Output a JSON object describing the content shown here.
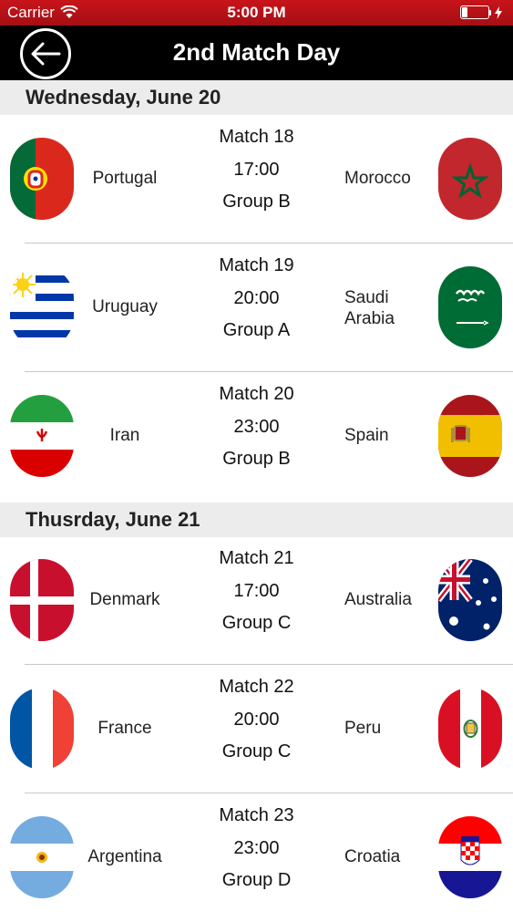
{
  "status_bar": {
    "carrier": "Carrier",
    "time": "5:00 PM"
  },
  "nav": {
    "title": "2nd Match Day",
    "back_icon": "arrow-left-icon"
  },
  "days": [
    {
      "label": "Wednesday, June 20",
      "matches": [
        {
          "match": "Match 18",
          "time": "17:00",
          "group": "Group B",
          "home": "Portugal",
          "away": "Morocco",
          "home_flag": "portugal-flag",
          "away_flag": "morocco-flag"
        },
        {
          "match": "Match 19",
          "time": "20:00",
          "group": "Group A",
          "home": "Uruguay",
          "away": "Saudi\nArabia",
          "home_flag": "uruguay-flag",
          "away_flag": "saudi-arabia-flag"
        },
        {
          "match": "Match 20",
          "time": "23:00",
          "group": "Group B",
          "home": "Iran",
          "away": "Spain",
          "home_flag": "iran-flag",
          "away_flag": "spain-flag"
        }
      ]
    },
    {
      "label": "Thusrday, June 21",
      "matches": [
        {
          "match": "Match 21",
          "time": "17:00",
          "group": "Group C",
          "home": "Denmark",
          "away": "Australia",
          "home_flag": "denmark-flag",
          "away_flag": "australia-flag"
        },
        {
          "match": "Match 22",
          "time": "20:00",
          "group": "Group C",
          "home": "France",
          "away": "Peru",
          "home_flag": "france-flag",
          "away_flag": "peru-flag"
        },
        {
          "match": "Match 23",
          "time": "23:00",
          "group": "Group D",
          "home": "Argentina",
          "away": "Croatia",
          "home_flag": "argentina-flag",
          "away_flag": "croatia-flag"
        }
      ]
    }
  ],
  "colors": {
    "status_bar": "#b8121a",
    "nav_bar": "#000000",
    "day_header_bg": "#ececec"
  }
}
